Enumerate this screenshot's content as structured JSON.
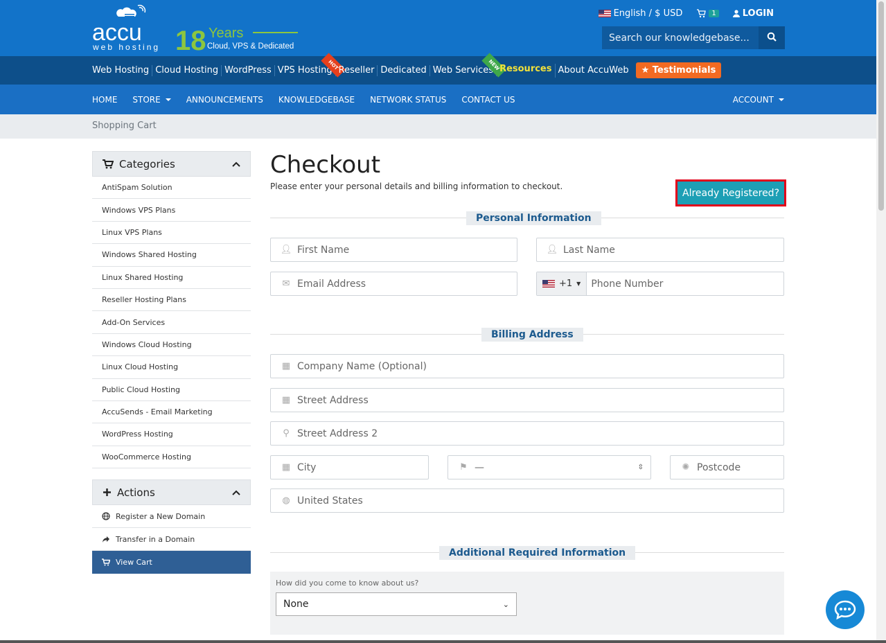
{
  "header": {
    "logo": {
      "brand_main": "accu",
      "brand_sub": "web hosting",
      "years_num": "18",
      "years_word": "Years",
      "years_tagline": "Cloud, VPS & Dedicated"
    },
    "language": "English / $ USD",
    "cart_count": "1",
    "login": "LOGIN",
    "search_placeholder": "Search our knowledgebase..."
  },
  "top_nav": {
    "items": [
      "Web Hosting",
      "Cloud Hosting",
      "WordPress",
      "VPS Hosting",
      "Reseller",
      "Dedicated",
      "Web Services",
      "Resources",
      "About AccuWeb"
    ],
    "hot_tag": "HOT",
    "new_tag": "NEW",
    "testimonials": "Testimonials"
  },
  "main_nav": {
    "items": [
      "HOME",
      "STORE",
      "ANNOUNCEMENTS",
      "KNOWLEDGEBASE",
      "NETWORK STATUS",
      "CONTACT US"
    ],
    "account": "ACCOUNT"
  },
  "breadcrumb": "Shopping Cart",
  "sidebar": {
    "categories_title": "Categories",
    "categories": [
      "AntiSpam Solution",
      "Windows VPS Plans",
      "Linux VPS Plans",
      "Windows Shared Hosting",
      "Linux Shared Hosting",
      "Reseller Hosting Plans",
      "Add-On Services",
      "Windows Cloud Hosting",
      "Linux Cloud Hosting",
      "Public Cloud Hosting",
      "AccuSends - Email Marketing",
      "WordPress Hosting",
      "WooCommerce Hosting"
    ],
    "actions_title": "Actions",
    "actions": [
      "Register a New Domain",
      "Transfer in a Domain",
      "View Cart"
    ]
  },
  "checkout": {
    "title": "Checkout",
    "subtitle": "Please enter your personal details and billing information to checkout.",
    "already_registered": "Already Registered?",
    "personal_title": "Personal Information",
    "first_name": "First Name",
    "last_name": "Last Name",
    "email": "Email Address",
    "phone_code": "+1",
    "phone": "Phone Number",
    "billing_title": "Billing Address",
    "company": "Company Name (Optional)",
    "street": "Street Address",
    "street2": "Street Address 2",
    "city": "City",
    "state": "—",
    "postcode": "Postcode",
    "country": "United States",
    "additional_title": "Additional Required Information",
    "how_label": "How did you come to know about us?",
    "how_value": "None"
  },
  "colors": {
    "header_blue": "#1273c9",
    "nav_dark": "#0d4f8a",
    "accent_teal": "#1d9fb5",
    "highlight_red": "#e2001a",
    "testimonials_orange": "#f26a22"
  }
}
